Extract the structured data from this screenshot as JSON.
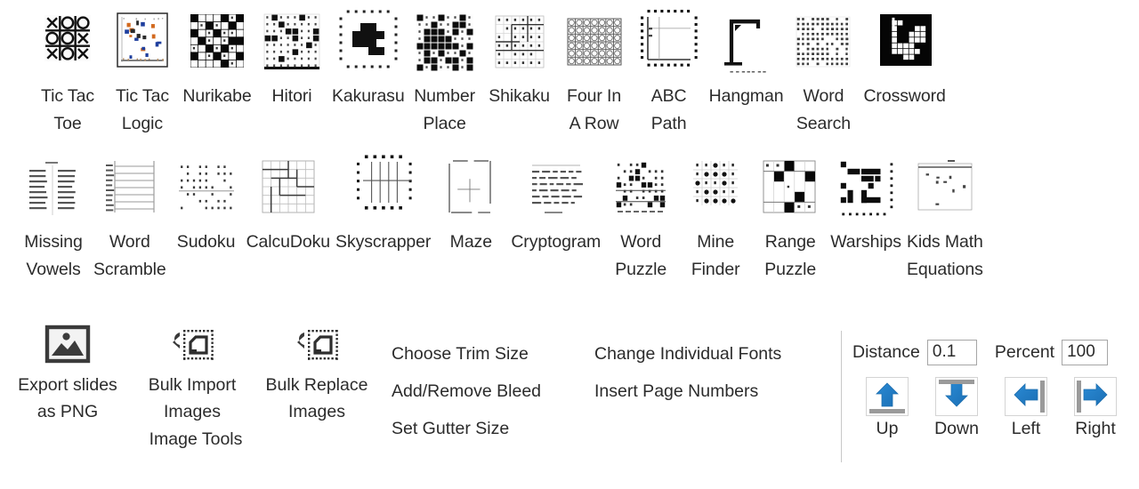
{
  "gallery": {
    "row1": [
      {
        "label": "Tic Tac\nToe",
        "icon": "tic-tac-toe-thumb"
      },
      {
        "label": "Tic Tac\nLogic",
        "icon": "tic-tac-logic-thumb"
      },
      {
        "label": "Nurikabe",
        "icon": "nurikabe-thumb"
      },
      {
        "label": "Hitori",
        "icon": "hitori-thumb"
      },
      {
        "label": "Kakurasu",
        "icon": "kakurasu-thumb"
      },
      {
        "label": "Number\nPlace",
        "icon": "number-place-thumb"
      },
      {
        "label": "Shikaku",
        "icon": "shikaku-thumb"
      },
      {
        "label": "Four In\nA Row",
        "icon": "four-in-a-row-thumb"
      },
      {
        "label": "ABC\nPath",
        "icon": "abc-path-thumb"
      },
      {
        "label": "Hangman",
        "icon": "hangman-thumb"
      },
      {
        "label": "Word\nSearch",
        "icon": "word-search-thumb"
      },
      {
        "label": "Crossword",
        "icon": "crossword-thumb"
      }
    ],
    "row2": [
      {
        "label": "Missing\nVowels",
        "icon": "missing-vowels-thumb"
      },
      {
        "label": "Word\nScramble",
        "icon": "word-scramble-thumb"
      },
      {
        "label": "Sudoku",
        "icon": "sudoku-thumb"
      },
      {
        "label": "CalcuDoku",
        "icon": "calcudoku-thumb"
      },
      {
        "label": "Skyscrapper",
        "icon": "skyscrapper-thumb"
      },
      {
        "label": "Maze",
        "icon": "maze-thumb"
      },
      {
        "label": "Cryptogram",
        "icon": "cryptogram-thumb"
      },
      {
        "label": "Word\nPuzzle",
        "icon": "word-puzzle-thumb"
      },
      {
        "label": "Mine\nFinder",
        "icon": "mine-finder-thumb"
      },
      {
        "label": "Range\nPuzzle",
        "icon": "range-puzzle-thumb"
      },
      {
        "label": "Warships",
        "icon": "warships-thumb"
      },
      {
        "label": "Kids Math\nEquations",
        "icon": "kids-math-equations-thumb"
      }
    ]
  },
  "image_tools": {
    "group_caption": "Image Tools",
    "items": [
      {
        "label": "Export slides\nas PNG",
        "icon": "picture-icon"
      },
      {
        "label": "Bulk Import\nImages",
        "icon": "bulk-import-icon"
      },
      {
        "label": "Bulk Replace\nImages",
        "icon": "bulk-replace-icon"
      }
    ]
  },
  "commands": {
    "column_a": [
      "Choose Trim Size",
      "Add/Remove Bleed",
      "Set Gutter Size"
    ],
    "column_b": [
      "Change Individual Fonts",
      "Insert Page Numbers"
    ]
  },
  "nudge": {
    "distance_label": "Distance",
    "distance_value": "0.1",
    "percent_label": "Percent",
    "percent_value": "100",
    "arrows": [
      {
        "label": "Up",
        "icon": "arrow-up-icon",
        "bar": "bar-bottom"
      },
      {
        "label": "Down",
        "icon": "arrow-down-icon",
        "bar": "bar-top"
      },
      {
        "label": "Left",
        "icon": "arrow-left-icon",
        "bar": "bar-right"
      },
      {
        "label": "Right",
        "icon": "arrow-right-icon",
        "bar": "bar-left"
      }
    ]
  },
  "colors": {
    "arrow_blue": "#2a8ad4",
    "arrow_blue_dark": "#1b6fb5",
    "text": "#2b2b2b",
    "divider": "#c8c8c8",
    "input_border": "#a6a6a6",
    "button_border": "#d4d4d4",
    "button_bar": "#9a9a9a"
  }
}
